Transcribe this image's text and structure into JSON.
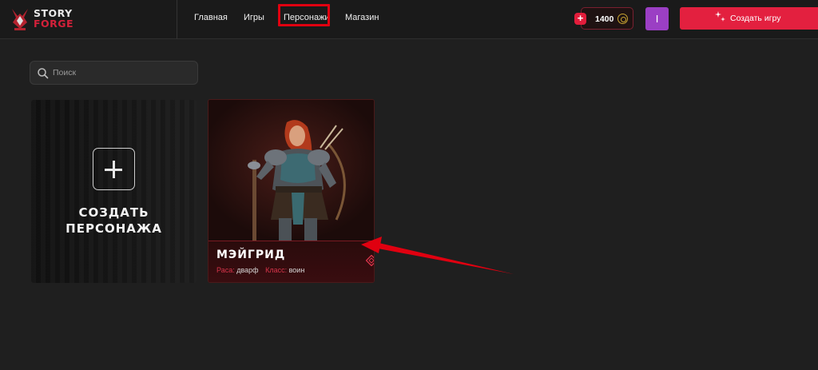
{
  "brand": {
    "line1": "STORY",
    "line2": "FORGE",
    "accent": "#d3213a"
  },
  "nav": {
    "items": [
      {
        "label": "Главная"
      },
      {
        "label": "Игры"
      },
      {
        "label": "Персонажи"
      },
      {
        "label": "Магазин"
      }
    ],
    "active_index": 2
  },
  "header": {
    "coins": "1400",
    "avatar_initial": "I",
    "create_game_label": "Создать игру"
  },
  "search": {
    "placeholder": "Поиск",
    "value": ""
  },
  "create_card": {
    "line1": "СОЗДАТЬ",
    "line2": "ПЕРСОНАЖА"
  },
  "characters": [
    {
      "name": "МЭЙГРИД",
      "race_label": "Раса:",
      "race": "дварф",
      "class_label": "Класс:",
      "class": "воин"
    }
  ],
  "colors": {
    "primary": "#e3203f",
    "avatar": "#9b3fc4",
    "annotation": "#e00010",
    "background": "#1f1f1f"
  },
  "icons": [
    "logo-mark-icon",
    "plus-icon",
    "coin-icon",
    "sparkle-icon",
    "search-icon",
    "diamond-icon"
  ]
}
